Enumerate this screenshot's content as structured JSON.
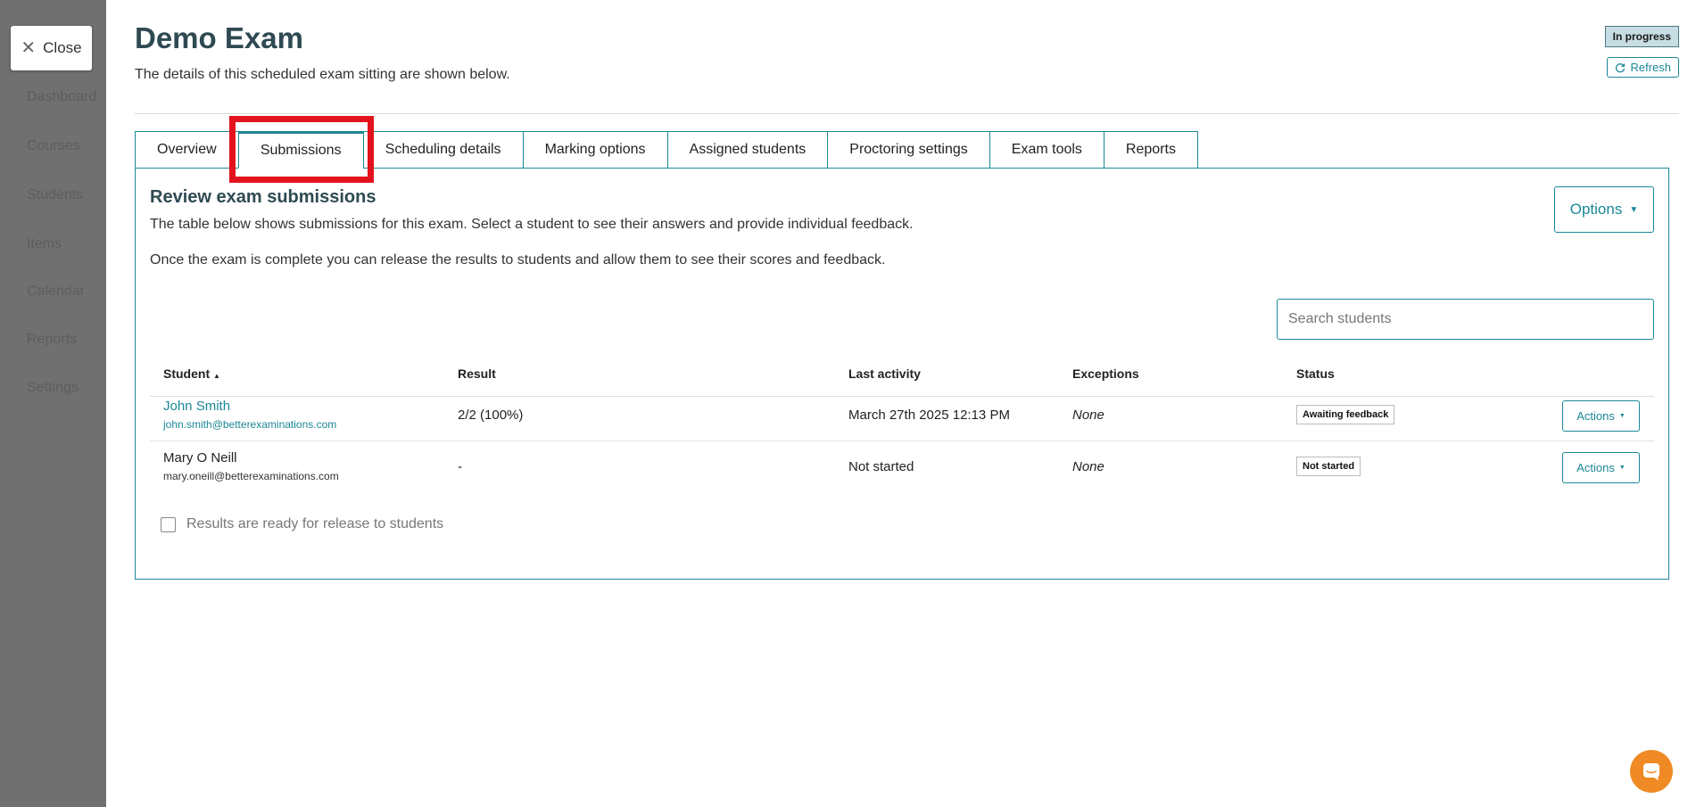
{
  "backdrop": {
    "nav_items": [
      "Dashboard",
      "Courses",
      "Students",
      "Items",
      "Calendar",
      "Reports",
      "Settings"
    ]
  },
  "close_button": {
    "label": "Close"
  },
  "header": {
    "title": "Demo Exam",
    "subtitle": "The details of this scheduled exam sitting are shown below.",
    "status": "In progress",
    "refresh_label": "Refresh"
  },
  "tabs": [
    {
      "label": "Overview",
      "active": false
    },
    {
      "label": "Submissions",
      "active": true
    },
    {
      "label": "Scheduling details",
      "active": false
    },
    {
      "label": "Marking options",
      "active": false
    },
    {
      "label": "Assigned students",
      "active": false
    },
    {
      "label": "Proctoring settings",
      "active": false
    },
    {
      "label": "Exam tools",
      "active": false
    },
    {
      "label": "Reports",
      "active": false
    }
  ],
  "submissions": {
    "heading": "Review exam submissions",
    "description_1": "The table below shows submissions for this exam. Select a student to see their answers and provide individual feedback.",
    "description_2": "Once the exam is complete you can release the results to students and allow them to see their scores and feedback.",
    "options_label": "Options",
    "search_placeholder": "Search students",
    "columns": {
      "student": "Student",
      "sort_indicator": "▲",
      "result": "Result",
      "last_activity": "Last activity",
      "exceptions": "Exceptions",
      "status": "Status"
    },
    "rows": [
      {
        "name": "John Smith",
        "email": "john.smith@betterexaminations.com",
        "result": "2/2 (100%)",
        "last_activity": "March 27th 2025 12:13 PM",
        "exceptions": "None",
        "status": "Awaiting feedback",
        "actions_label": "Actions"
      },
      {
        "name": "Mary O Neill",
        "email": "mary.oneill@betterexaminations.com",
        "result": "-",
        "last_activity": "Not started",
        "exceptions": "None",
        "status": "Not started",
        "actions_label": "Actions"
      }
    ],
    "release_label": "Results are ready for release to students"
  },
  "colors": {
    "accent": "#1b8796",
    "heading": "#2f4a52",
    "highlight": "#e3131d",
    "chat": "#f08a24"
  }
}
